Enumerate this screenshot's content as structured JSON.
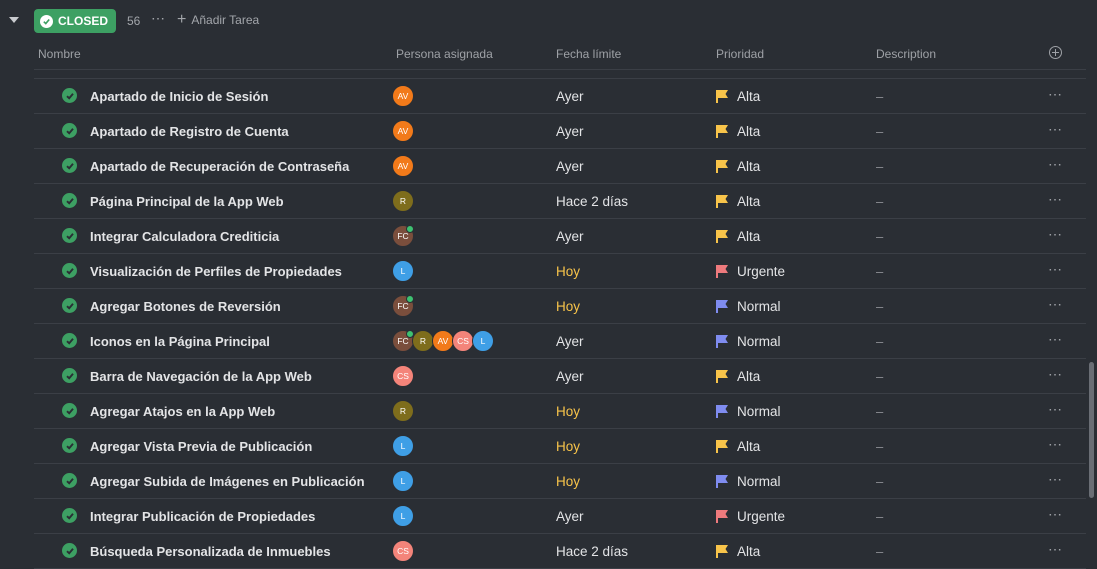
{
  "group": {
    "status_label": "CLOSED",
    "status_color": "#3da063",
    "count": "56",
    "more_icon": "⋯",
    "add_task_label": "Añadir Tarea"
  },
  "columns": {
    "name": "Nombre",
    "assignee": "Persona asignada",
    "due": "Fecha límite",
    "priority": "Prioridad",
    "description": "Description"
  },
  "colors": {
    "alta": "#f8c44a",
    "urgente": "#ee7a7d",
    "normal": "#7f8cf0",
    "due_today": "#f8c44a",
    "due_default": "#e3e4e6"
  },
  "tasks": [
    {
      "name": "Apartado de Inicio de Sesión",
      "assignees": [
        {
          "initials": "AV",
          "color": "#f27a1a",
          "online": false
        }
      ],
      "due": "Ayer",
      "due_highlight": false,
      "priority": "Alta",
      "priority_color": "#f8c44a",
      "description": "–"
    },
    {
      "name": "Apartado de Registro de Cuenta",
      "assignees": [
        {
          "initials": "AV",
          "color": "#f27a1a",
          "online": false
        }
      ],
      "due": "Ayer",
      "due_highlight": false,
      "priority": "Alta",
      "priority_color": "#f8c44a",
      "description": "–"
    },
    {
      "name": "Apartado de Recuperación de Contraseña",
      "assignees": [
        {
          "initials": "AV",
          "color": "#f27a1a",
          "online": false
        }
      ],
      "due": "Ayer",
      "due_highlight": false,
      "priority": "Alta",
      "priority_color": "#f8c44a",
      "description": "–"
    },
    {
      "name": "Página Principal de la App Web",
      "assignees": [
        {
          "initials": "R",
          "color": "#7e6d1c",
          "online": false
        }
      ],
      "due": "Hace 2 días",
      "due_highlight": false,
      "priority": "Alta",
      "priority_color": "#f8c44a",
      "description": "–"
    },
    {
      "name": "Integrar Calculadora Crediticia",
      "assignees": [
        {
          "initials": "FC",
          "color": "#7a4e3c",
          "online": true
        }
      ],
      "due": "Ayer",
      "due_highlight": false,
      "priority": "Alta",
      "priority_color": "#f8c44a",
      "description": "–"
    },
    {
      "name": "Visualización de Perfiles de Propiedades",
      "assignees": [
        {
          "initials": "L",
          "color": "#3f9fe6",
          "online": false
        }
      ],
      "due": "Hoy",
      "due_highlight": true,
      "priority": "Urgente",
      "priority_color": "#ee7a7d",
      "description": "–"
    },
    {
      "name": "Agregar Botones de Reversión",
      "assignees": [
        {
          "initials": "FC",
          "color": "#7a4e3c",
          "online": true
        }
      ],
      "due": "Hoy",
      "due_highlight": true,
      "priority": "Normal",
      "priority_color": "#7f8cf0",
      "description": "–"
    },
    {
      "name": "Iconos en la Página Principal",
      "assignees": [
        {
          "initials": "FC",
          "color": "#7a4e3c",
          "online": true
        },
        {
          "initials": "R",
          "color": "#7e6d1c",
          "online": false
        },
        {
          "initials": "AV",
          "color": "#f27a1a",
          "online": false
        },
        {
          "initials": "CS",
          "color": "#f4847a",
          "online": false
        },
        {
          "initials": "L",
          "color": "#3f9fe6",
          "online": false
        }
      ],
      "due": "Ayer",
      "due_highlight": false,
      "priority": "Normal",
      "priority_color": "#7f8cf0",
      "description": "–"
    },
    {
      "name": "Barra de Navegación de la App Web",
      "assignees": [
        {
          "initials": "CS",
          "color": "#f4847a",
          "online": false
        }
      ],
      "due": "Ayer",
      "due_highlight": false,
      "priority": "Alta",
      "priority_color": "#f8c44a",
      "description": "–"
    },
    {
      "name": "Agregar Atajos en la App Web",
      "assignees": [
        {
          "initials": "R",
          "color": "#7e6d1c",
          "online": false
        }
      ],
      "due": "Hoy",
      "due_highlight": true,
      "priority": "Normal",
      "priority_color": "#7f8cf0",
      "description": "–"
    },
    {
      "name": "Agregar Vista Previa de Publicación",
      "assignees": [
        {
          "initials": "L",
          "color": "#3f9fe6",
          "online": false
        }
      ],
      "due": "Hoy",
      "due_highlight": true,
      "priority": "Alta",
      "priority_color": "#f8c44a",
      "description": "–"
    },
    {
      "name": "Agregar Subida de Imágenes en Publicación",
      "assignees": [
        {
          "initials": "L",
          "color": "#3f9fe6",
          "online": false
        }
      ],
      "due": "Hoy",
      "due_highlight": true,
      "priority": "Normal",
      "priority_color": "#7f8cf0",
      "description": "–"
    },
    {
      "name": "Integrar Publicación de Propiedades",
      "assignees": [
        {
          "initials": "L",
          "color": "#3f9fe6",
          "online": false
        }
      ],
      "due": "Ayer",
      "due_highlight": false,
      "priority": "Urgente",
      "priority_color": "#ee7a7d",
      "description": "–"
    },
    {
      "name": "Búsqueda Personalizada de Inmuebles",
      "assignees": [
        {
          "initials": "CS",
          "color": "#f4847a",
          "online": false
        }
      ],
      "due": "Hace 2 días",
      "due_highlight": false,
      "priority": "Alta",
      "priority_color": "#f8c44a",
      "description": "–"
    }
  ]
}
